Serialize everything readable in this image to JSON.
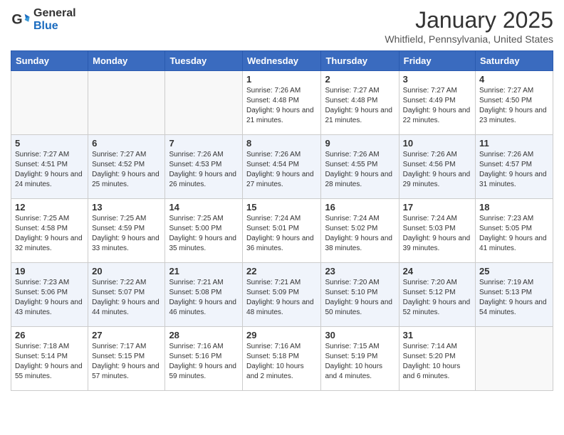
{
  "header": {
    "logo_general": "General",
    "logo_blue": "Blue",
    "month": "January 2025",
    "location": "Whitfield, Pennsylvania, United States"
  },
  "weekdays": [
    "Sunday",
    "Monday",
    "Tuesday",
    "Wednesday",
    "Thursday",
    "Friday",
    "Saturday"
  ],
  "weeks": [
    [
      {
        "day": "",
        "info": ""
      },
      {
        "day": "",
        "info": ""
      },
      {
        "day": "",
        "info": ""
      },
      {
        "day": "1",
        "info": "Sunrise: 7:26 AM\nSunset: 4:48 PM\nDaylight: 9 hours and 21 minutes."
      },
      {
        "day": "2",
        "info": "Sunrise: 7:27 AM\nSunset: 4:48 PM\nDaylight: 9 hours and 21 minutes."
      },
      {
        "day": "3",
        "info": "Sunrise: 7:27 AM\nSunset: 4:49 PM\nDaylight: 9 hours and 22 minutes."
      },
      {
        "day": "4",
        "info": "Sunrise: 7:27 AM\nSunset: 4:50 PM\nDaylight: 9 hours and 23 minutes."
      }
    ],
    [
      {
        "day": "5",
        "info": "Sunrise: 7:27 AM\nSunset: 4:51 PM\nDaylight: 9 hours and 24 minutes."
      },
      {
        "day": "6",
        "info": "Sunrise: 7:27 AM\nSunset: 4:52 PM\nDaylight: 9 hours and 25 minutes."
      },
      {
        "day": "7",
        "info": "Sunrise: 7:26 AM\nSunset: 4:53 PM\nDaylight: 9 hours and 26 minutes."
      },
      {
        "day": "8",
        "info": "Sunrise: 7:26 AM\nSunset: 4:54 PM\nDaylight: 9 hours and 27 minutes."
      },
      {
        "day": "9",
        "info": "Sunrise: 7:26 AM\nSunset: 4:55 PM\nDaylight: 9 hours and 28 minutes."
      },
      {
        "day": "10",
        "info": "Sunrise: 7:26 AM\nSunset: 4:56 PM\nDaylight: 9 hours and 29 minutes."
      },
      {
        "day": "11",
        "info": "Sunrise: 7:26 AM\nSunset: 4:57 PM\nDaylight: 9 hours and 31 minutes."
      }
    ],
    [
      {
        "day": "12",
        "info": "Sunrise: 7:25 AM\nSunset: 4:58 PM\nDaylight: 9 hours and 32 minutes."
      },
      {
        "day": "13",
        "info": "Sunrise: 7:25 AM\nSunset: 4:59 PM\nDaylight: 9 hours and 33 minutes."
      },
      {
        "day": "14",
        "info": "Sunrise: 7:25 AM\nSunset: 5:00 PM\nDaylight: 9 hours and 35 minutes."
      },
      {
        "day": "15",
        "info": "Sunrise: 7:24 AM\nSunset: 5:01 PM\nDaylight: 9 hours and 36 minutes."
      },
      {
        "day": "16",
        "info": "Sunrise: 7:24 AM\nSunset: 5:02 PM\nDaylight: 9 hours and 38 minutes."
      },
      {
        "day": "17",
        "info": "Sunrise: 7:24 AM\nSunset: 5:03 PM\nDaylight: 9 hours and 39 minutes."
      },
      {
        "day": "18",
        "info": "Sunrise: 7:23 AM\nSunset: 5:05 PM\nDaylight: 9 hours and 41 minutes."
      }
    ],
    [
      {
        "day": "19",
        "info": "Sunrise: 7:23 AM\nSunset: 5:06 PM\nDaylight: 9 hours and 43 minutes."
      },
      {
        "day": "20",
        "info": "Sunrise: 7:22 AM\nSunset: 5:07 PM\nDaylight: 9 hours and 44 minutes."
      },
      {
        "day": "21",
        "info": "Sunrise: 7:21 AM\nSunset: 5:08 PM\nDaylight: 9 hours and 46 minutes."
      },
      {
        "day": "22",
        "info": "Sunrise: 7:21 AM\nSunset: 5:09 PM\nDaylight: 9 hours and 48 minutes."
      },
      {
        "day": "23",
        "info": "Sunrise: 7:20 AM\nSunset: 5:10 PM\nDaylight: 9 hours and 50 minutes."
      },
      {
        "day": "24",
        "info": "Sunrise: 7:20 AM\nSunset: 5:12 PM\nDaylight: 9 hours and 52 minutes."
      },
      {
        "day": "25",
        "info": "Sunrise: 7:19 AM\nSunset: 5:13 PM\nDaylight: 9 hours and 54 minutes."
      }
    ],
    [
      {
        "day": "26",
        "info": "Sunrise: 7:18 AM\nSunset: 5:14 PM\nDaylight: 9 hours and 55 minutes."
      },
      {
        "day": "27",
        "info": "Sunrise: 7:17 AM\nSunset: 5:15 PM\nDaylight: 9 hours and 57 minutes."
      },
      {
        "day": "28",
        "info": "Sunrise: 7:16 AM\nSunset: 5:16 PM\nDaylight: 9 hours and 59 minutes."
      },
      {
        "day": "29",
        "info": "Sunrise: 7:16 AM\nSunset: 5:18 PM\nDaylight: 10 hours and 2 minutes."
      },
      {
        "day": "30",
        "info": "Sunrise: 7:15 AM\nSunset: 5:19 PM\nDaylight: 10 hours and 4 minutes."
      },
      {
        "day": "31",
        "info": "Sunrise: 7:14 AM\nSunset: 5:20 PM\nDaylight: 10 hours and 6 minutes."
      },
      {
        "day": "",
        "info": ""
      }
    ]
  ]
}
